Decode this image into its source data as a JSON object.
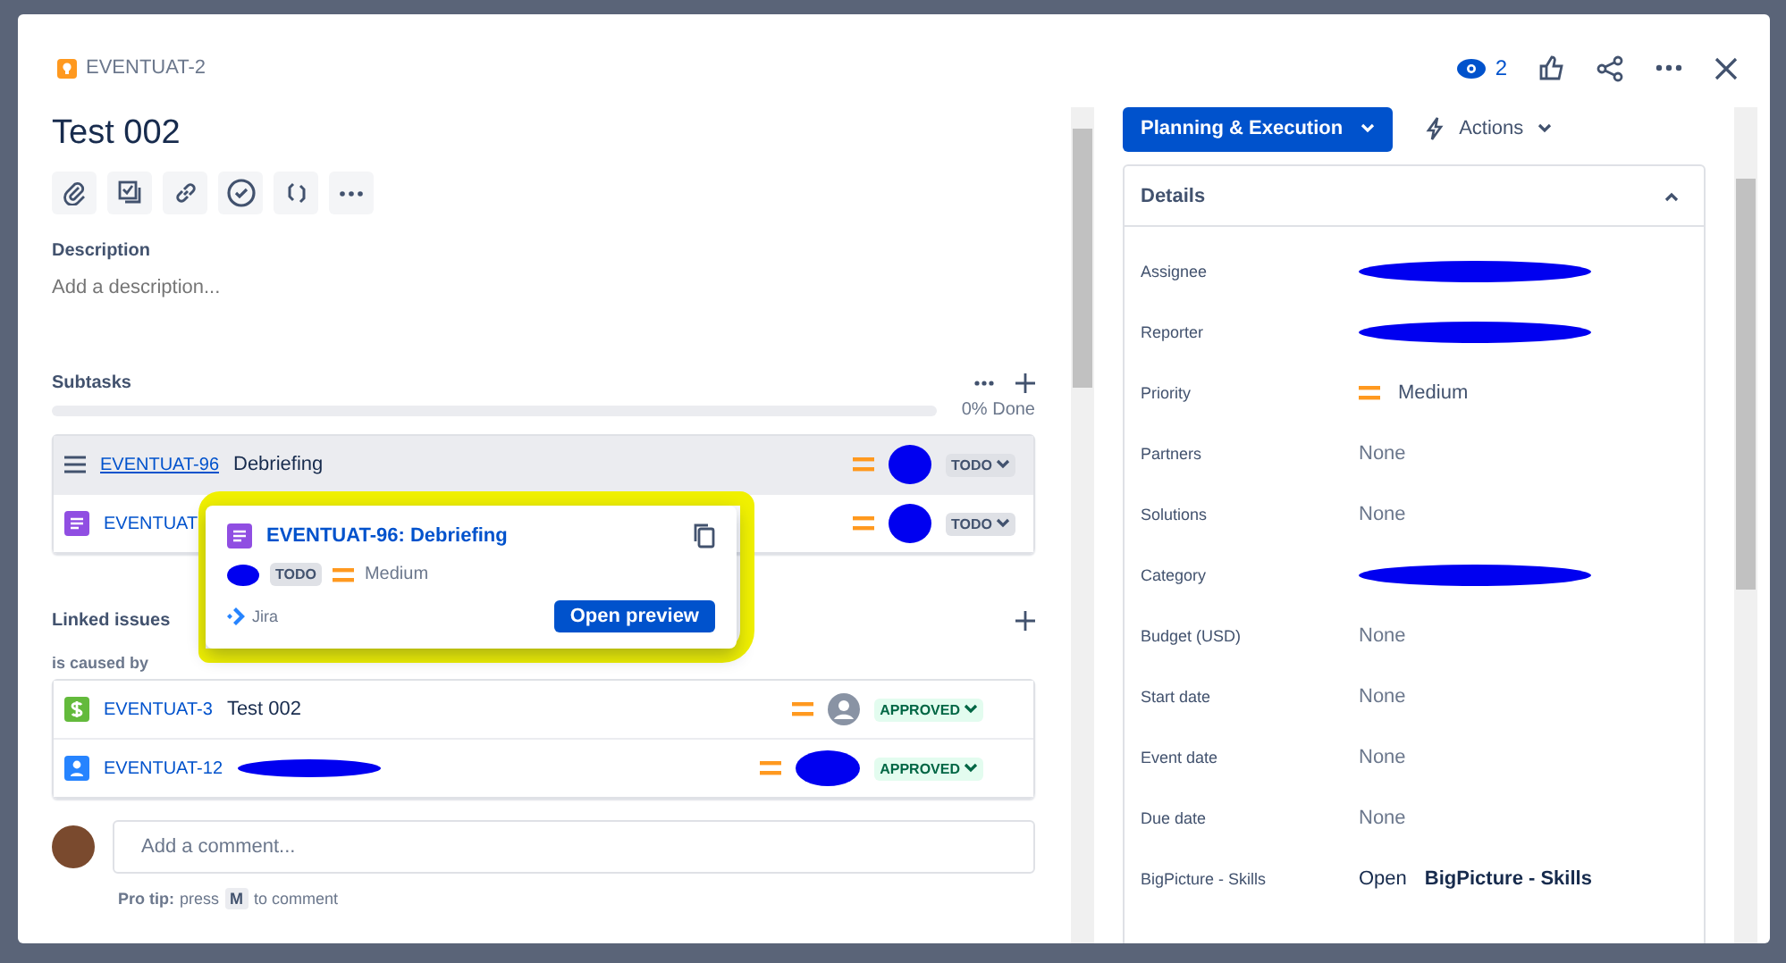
{
  "issue": {
    "key": "EVENTUAT-2",
    "title": "Test 002",
    "watchers": "2"
  },
  "description": {
    "heading": "Description",
    "placeholder": "Add a description..."
  },
  "subtasks": {
    "heading": "Subtasks",
    "progress_label": "0% Done",
    "level": 0,
    "rows": [
      {
        "kind": "lines",
        "key": "EVENTUAT-96",
        "summary": "Debriefing",
        "status": "TODO",
        "selected": true,
        "assignee_redacted": true
      },
      {
        "kind": "story",
        "key": "EVENTUAT",
        "summary": "",
        "status": "TODO",
        "selected": false,
        "assignee_redacted": true
      }
    ]
  },
  "preview": {
    "title": "EVENTUAT-96: Debriefing",
    "status": "TODO",
    "priority": "Medium",
    "source": "Jira",
    "button": "Open preview",
    "highlighted": true
  },
  "linked": {
    "heading": "Linked issues",
    "relation": "is caused by",
    "rows": [
      {
        "kind": "dollar",
        "key": "EVENTUAT-3",
        "summary": "Test 002",
        "status": "APPROVED",
        "redacted": false
      },
      {
        "kind": "person",
        "key": "EVENTUAT-12",
        "summary": "",
        "status": "APPROVED",
        "redacted": true
      }
    ]
  },
  "comment": {
    "placeholder": "Add a comment...",
    "tip_bold": "Pro tip:",
    "tip_press": "press",
    "tip_key": "M",
    "tip_end": "to comment"
  },
  "workflow": {
    "status_button": "Planning & Execution",
    "actions": "Actions"
  },
  "details": {
    "heading": "Details",
    "expanded": true,
    "fields": [
      {
        "label": "Assignee",
        "kind": "redacted"
      },
      {
        "label": "Reporter",
        "kind": "redacted"
      },
      {
        "label": "Priority",
        "kind": "priority",
        "value": "Medium"
      },
      {
        "label": "Partners",
        "kind": "text",
        "value": "None"
      },
      {
        "label": "Solutions",
        "kind": "text",
        "value": "None"
      },
      {
        "label": "Category",
        "kind": "redacted"
      },
      {
        "label": "Budget (USD)",
        "kind": "text",
        "value": "None"
      },
      {
        "label": "Start date",
        "kind": "text",
        "value": "None"
      },
      {
        "label": "Event date",
        "kind": "text",
        "value": "None"
      },
      {
        "label": "Due date",
        "kind": "text",
        "value": "None"
      },
      {
        "label": "BigPicture - Skills",
        "kind": "link",
        "value": "Open **BigPicture - Skills**"
      }
    ]
  }
}
